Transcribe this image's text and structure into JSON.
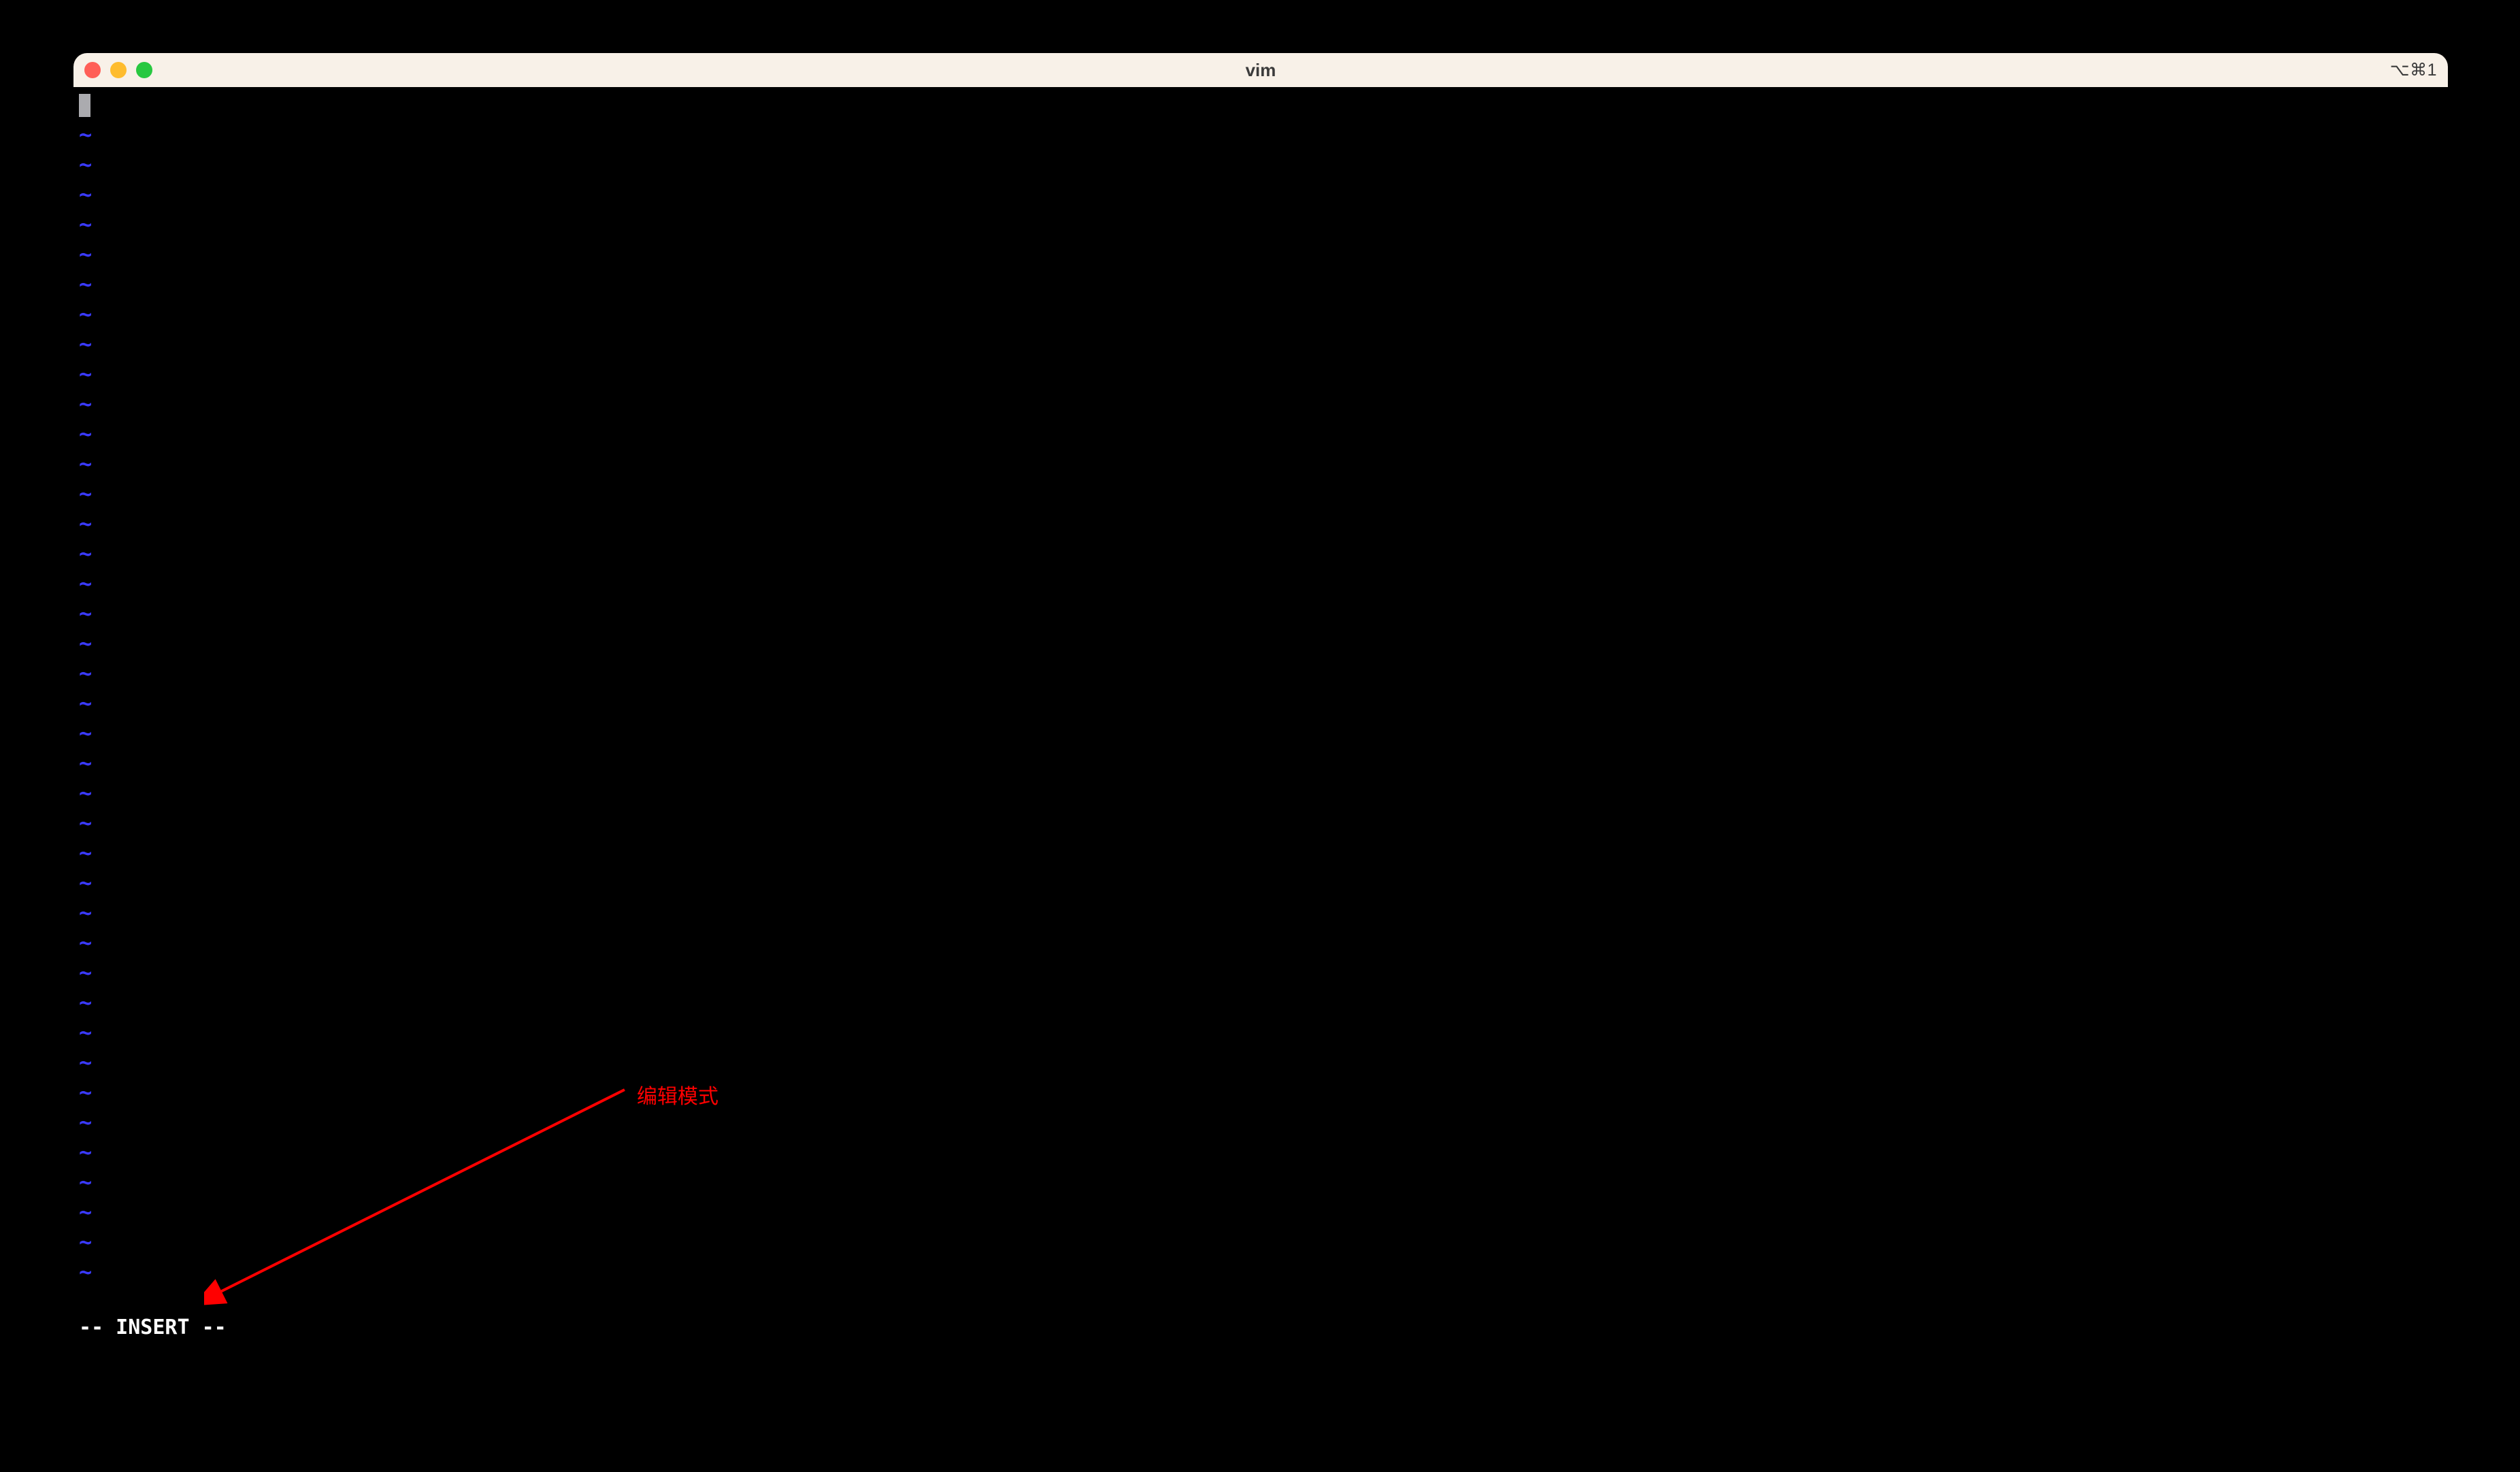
{
  "titlebar": {
    "title": "vim",
    "shortcut": "⌥⌘1"
  },
  "editor": {
    "tilde": "~",
    "tilde_count": 39,
    "status_line": "-- INSERT --"
  },
  "annotation": {
    "label": "编辑模式"
  }
}
